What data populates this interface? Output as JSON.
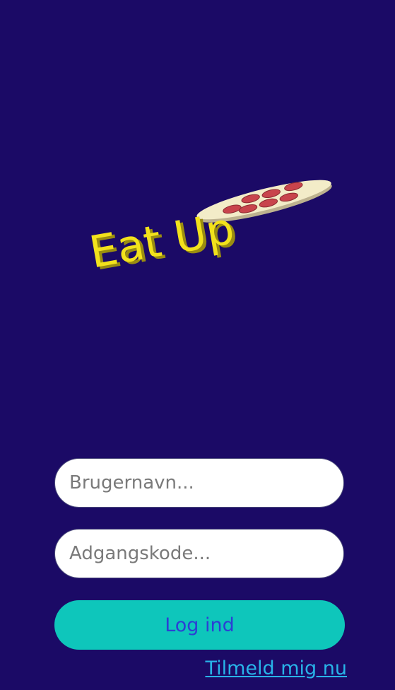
{
  "logo": {
    "text": "Eat Up",
    "text_color": "#f2e21c",
    "paddle_color": "#f3ecc8",
    "topping_color": "#c8444c"
  },
  "form": {
    "username_placeholder": "Brugernavn...",
    "password_placeholder": "Adgangskode...",
    "login_label": "Log ind",
    "signup_label": "Tilmeld mig nu"
  },
  "colors": {
    "background": "#1b0a66",
    "button": "#0ec6bb",
    "button_text": "#2c3fd4",
    "link": "#28b3e8"
  }
}
